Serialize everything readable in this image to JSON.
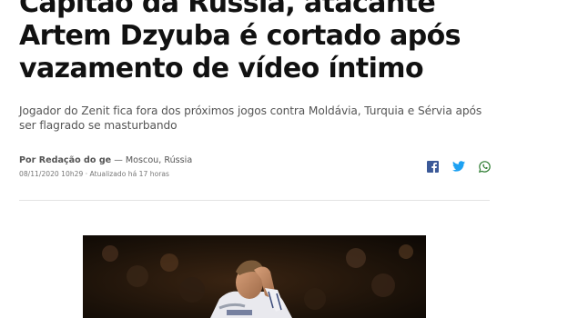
{
  "article": {
    "title": "Capitão da Rússia, atacante Artem Dzyuba é cortado após vazamento de vídeo íntimo",
    "subtitle": "Jogador do Zenit fica fora dos próximos jogos contra Moldávia, Turquia e Sérvia após ser flagrado se masturbando",
    "author": "Por Redação do ge",
    "location": " — Moscou, Rússia",
    "datetime": "08/11/2020 10h29 · Atualizado há 17 horas"
  },
  "share": {
    "items": [
      {
        "icon": "facebook-icon",
        "color": "#3b5998"
      },
      {
        "icon": "twitter-icon",
        "color": "#1da1f2"
      },
      {
        "icon": "whatsapp-icon",
        "color": "#4caf50"
      }
    ]
  },
  "colors": {
    "headline": "#111111",
    "subtitle": "#555555",
    "meta": "#777777",
    "divider": "#e3e3e3"
  }
}
